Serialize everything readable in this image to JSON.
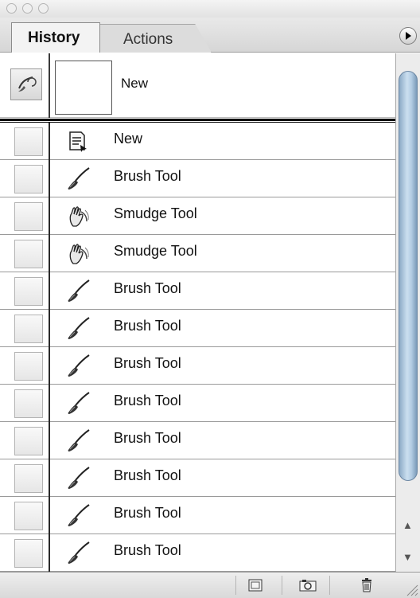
{
  "window": {
    "traffic_lights": [
      "close",
      "minimize",
      "zoom"
    ]
  },
  "tabs": [
    {
      "label": "History",
      "active": true
    },
    {
      "label": "Actions",
      "active": false
    }
  ],
  "snapshot": {
    "label": "New"
  },
  "history_items": [
    {
      "icon": "new-document-icon",
      "label": "New"
    },
    {
      "icon": "brush-icon",
      "label": "Brush Tool"
    },
    {
      "icon": "smudge-icon",
      "label": "Smudge Tool"
    },
    {
      "icon": "smudge-icon",
      "label": "Smudge Tool"
    },
    {
      "icon": "brush-icon",
      "label": "Brush Tool"
    },
    {
      "icon": "brush-icon",
      "label": "Brush Tool"
    },
    {
      "icon": "brush-icon",
      "label": "Brush Tool"
    },
    {
      "icon": "brush-icon",
      "label": "Brush Tool"
    },
    {
      "icon": "brush-icon",
      "label": "Brush Tool"
    },
    {
      "icon": "brush-icon",
      "label": "Brush Tool"
    },
    {
      "icon": "brush-icon",
      "label": "Brush Tool"
    },
    {
      "icon": "brush-icon",
      "label": "Brush Tool"
    }
  ],
  "bottom_buttons": [
    "new-document-from-state-icon",
    "camera-icon",
    "trash-icon"
  ],
  "colors": {
    "scroll_thumb": "#b2cbe2",
    "row_line": "#9a9a9a"
  }
}
